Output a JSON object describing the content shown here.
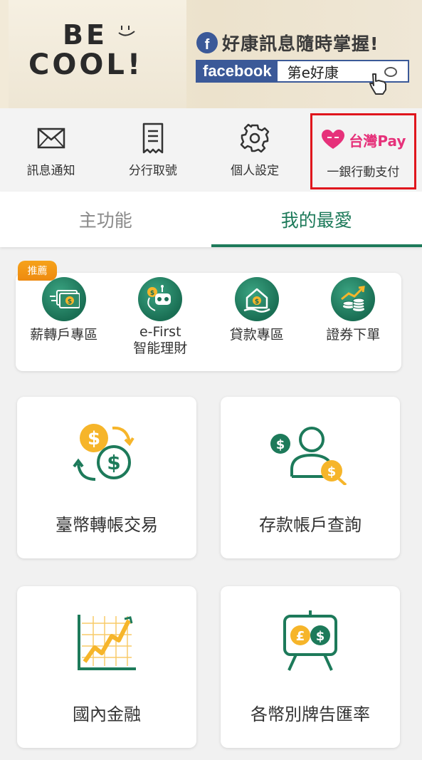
{
  "banner": {
    "poster_line1": "BE",
    "poster_line2": "COOL!",
    "slogan": "好康訊息隨時掌握!",
    "fb_letter": "f",
    "fb_word": "facebook",
    "fb_search_text": "第e好康"
  },
  "quick_actions": [
    {
      "label": "訊息通知",
      "icon": "envelope-icon"
    },
    {
      "label": "分行取號",
      "icon": "ticket-icon"
    },
    {
      "label": "個人設定",
      "icon": "gear-icon"
    },
    {
      "label": "一銀行動支付",
      "icon": "taiwan-pay-logo",
      "logo_text": "台灣Pay"
    }
  ],
  "tabs": [
    {
      "label": "主功能",
      "active": false
    },
    {
      "label": "我的最愛",
      "active": true
    }
  ],
  "recommend": {
    "badge": "推薦",
    "items": [
      {
        "label": "薪轉戶專區",
        "icon": "money-transfer-icon"
      },
      {
        "label_line1": "e-First",
        "label_line2": "智能理財",
        "icon": "robo-advisor-icon"
      },
      {
        "label": "貸款專區",
        "icon": "home-loan-icon"
      },
      {
        "label": "證券下單",
        "icon": "securities-icon"
      }
    ]
  },
  "functions": [
    {
      "label": "臺幣轉帳交易",
      "icon": "currency-exchange-icon"
    },
    {
      "label": "存款帳戶查詢",
      "icon": "account-search-icon"
    },
    {
      "label": "國內金融",
      "icon": "growth-chart-icon"
    },
    {
      "label": "各幣別牌告匯率",
      "icon": "forex-board-icon"
    }
  ],
  "colors": {
    "primary_green": "#1d7a5a",
    "accent_orange": "#f6a21a",
    "highlight_red": "#e0161d",
    "facebook_blue": "#3b5998",
    "taiwanpay_pink": "#e6317a"
  }
}
